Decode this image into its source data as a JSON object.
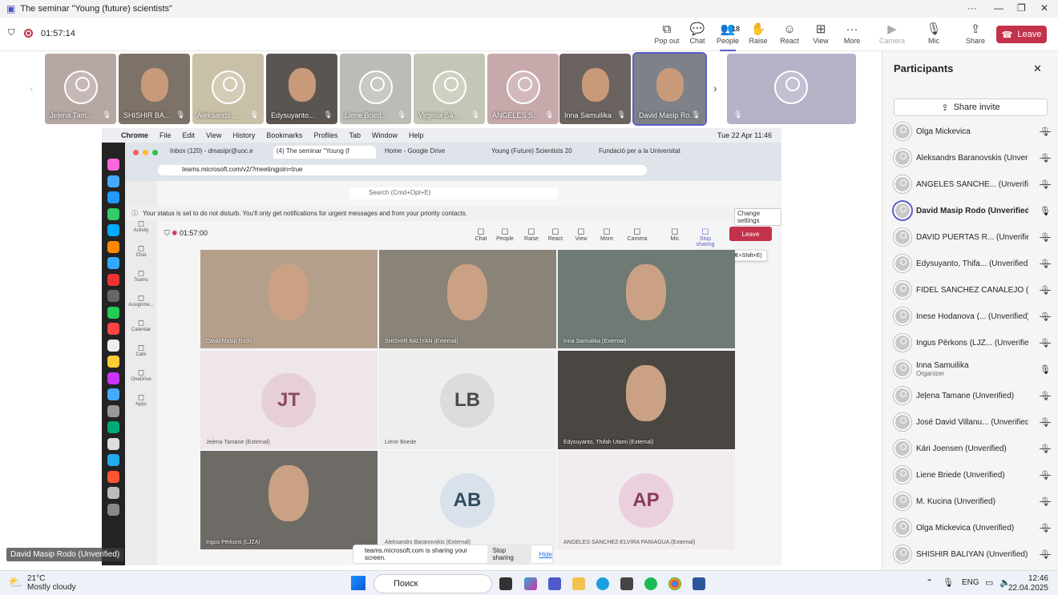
{
  "window": {
    "title": "The seminar \"Young (future) scientists\""
  },
  "meeting": {
    "timer": "01:57:14"
  },
  "toolbar": [
    {
      "label": "Pop out",
      "icon": "pop-out-icon"
    },
    {
      "label": "Chat",
      "icon": "chat-icon"
    },
    {
      "label": "People",
      "icon": "people-icon",
      "count": "18"
    },
    {
      "label": "Raise",
      "icon": "raise-hand-icon"
    },
    {
      "label": "React",
      "icon": "react-icon"
    },
    {
      "label": "View",
      "icon": "view-icon"
    },
    {
      "label": "More",
      "icon": "more-icon"
    },
    {
      "label": "Camera",
      "icon": "camera-icon"
    },
    {
      "label": "Mic",
      "icon": "mic-icon"
    },
    {
      "label": "Share",
      "icon": "share-icon"
    }
  ],
  "leave_label": "Leave",
  "strip": [
    {
      "name": "Jeļena Tam...",
      "bg": "#b7a7a3",
      "photo": false
    },
    {
      "name": "SHISHIR BA...",
      "bg": "#7d7268",
      "photo": true
    },
    {
      "name": "Aleksands ...",
      "bg": "#c8c1a7",
      "photo": false
    },
    {
      "name": "Edysuyanto...",
      "bg": "#5a5550",
      "photo": true
    },
    {
      "name": "Liene Bried...",
      "bg": "#b9bdb6",
      "photo": false
    },
    {
      "name": "Virginia Sá...",
      "bg": "#c3c7b5",
      "photo": false
    },
    {
      "name": "ANGELES S...",
      "bg": "#c7a9ac",
      "photo": false
    },
    {
      "name": "Inna Samuilika",
      "bg": "#6b6360",
      "photo": true
    },
    {
      "name": "David Masip Ro...",
      "bg": "#7e8188",
      "photo": true
    },
    {
      "name": "",
      "bg": "#b5b1c7",
      "photo": false
    }
  ],
  "shared": {
    "mac_menu": [
      "Chrome",
      "File",
      "Edit",
      "View",
      "History",
      "Bookmarks",
      "Profiles",
      "Tab",
      "Window",
      "Help"
    ],
    "mac_clock": "Tue 22 Apr  11:46",
    "tabs": [
      "Inbox (120) - dmasipr@uoc.e",
      "(4) The seminar \"Young (f",
      "Home - Google Drive",
      "Young (Future) Scientists 20",
      "Fundació per a la Universitat"
    ],
    "url": "teams.microsoft.com/v2/?meetingjoin=true",
    "search": "Search (Cmd+Opt+E)",
    "banner": "Your status is set to do not disturb. You'll only get notifications for urgent messages and from your priority contacts.",
    "change_settings": "Change settings",
    "timer": "01:57:00",
    "rail": [
      "Activity",
      "Chat",
      "Teams",
      "Assignme...",
      "Calendar",
      "Calls",
      "OneDrive",
      "Apps"
    ],
    "controls": [
      "Chat",
      "People",
      "Raise",
      "React",
      "View",
      "More",
      "Camera",
      "Mic",
      "Stop sharing"
    ],
    "people_count": "18",
    "leave": "Leave",
    "tooltip": "Stop sharing (⌘+Shift+E)",
    "grid": [
      {
        "label": "David Masip Rodo",
        "initials": "",
        "bg": "#b4a08a"
      },
      {
        "label": "SHISHIR BALIYAN (External)",
        "initials": "",
        "bg": "#8a8378"
      },
      {
        "label": "Inna Samuilika (External)",
        "initials": "",
        "bg": "#6f7a74"
      },
      {
        "label": "Jeļena Tamane (External)",
        "initials": "JT",
        "bg": "#efe6ea",
        "ini_bg": "#e6cfd8",
        "ini_color": "#8b4c5f"
      },
      {
        "label": "Liene Briede",
        "initials": "LB",
        "bg": "#eeeeef",
        "ini_bg": "#dcdcde",
        "ini_color": "#4a4a4a"
      },
      {
        "label": "Edysuyanto, Thifah Utami (External)",
        "initials": "",
        "bg": "#4a4641"
      },
      {
        "label": "Ingus Pērkons (LJZA)",
        "initials": "",
        "bg": "#6e6a66"
      },
      {
        "label": "Aleksandrs Baranovskis (External)",
        "initials": "AB",
        "bg": "#eef0f2",
        "ini_bg": "#d9e2ea",
        "ini_color": "#2f4a5e"
      },
      {
        "label": "ANGELES SANCHEZ-ELVIRA PANIAGUA (External)",
        "initials": "AP",
        "bg": "#f1ecef",
        "ini_bg": "#ead0dc",
        "ini_color": "#8a3a5e"
      }
    ],
    "sharing_text": "teams.microsoft.com is sharing your screen.",
    "stop_sharing": "Stop sharing",
    "hide": "Hide"
  },
  "selfview_label": "David Masip Rodo (Unverified)",
  "panel": {
    "title": "Participants",
    "share_invite": "Share invite",
    "people": [
      {
        "name": "Olga Mickevica",
        "sub": "",
        "mic": "muted"
      },
      {
        "name": "Aleksandrs Baranovskis (Unver...",
        "sub": "",
        "mic": "muted"
      },
      {
        "name": "ANGELES SANCHE... (Unverified)",
        "sub": "",
        "mic": "muted"
      },
      {
        "name": "David Masip Rodo (Unverified)",
        "sub": "",
        "mic": "on",
        "bold": true
      },
      {
        "name": "DAVID PUERTAS R... (Unverified)",
        "sub": "",
        "mic": "muted"
      },
      {
        "name": "Edysuyanto, Thifa... (Unverified)",
        "sub": "",
        "mic": "muted"
      },
      {
        "name": "FIDEL SÁNCHEZ CANALEJO (U...",
        "sub": "",
        "mic": "muted"
      },
      {
        "name": "Inese Hodanova (... (Unverified)",
        "sub": "",
        "mic": "muted"
      },
      {
        "name": "Ingus Pērkons (LJZ... (Unverified)",
        "sub": "",
        "mic": "muted"
      },
      {
        "name": "Inna Samuilika",
        "sub": "Organizer",
        "mic": "on"
      },
      {
        "name": "Jeļena Tamane (Unverified)",
        "sub": "",
        "mic": "muted"
      },
      {
        "name": "José David Villanu... (Unverified)",
        "sub": "",
        "mic": "muted"
      },
      {
        "name": "Kári Joensen (Unverified)",
        "sub": "",
        "mic": "muted"
      },
      {
        "name": "Liene Briede (Unverified)",
        "sub": "",
        "mic": "muted"
      },
      {
        "name": "M. Kucina (Unverified)",
        "sub": "",
        "mic": "muted"
      },
      {
        "name": "Olga Mickevica (Unverified)",
        "sub": "",
        "mic": "muted"
      },
      {
        "name": "SHISHIR BALIYAN (Unverified)",
        "sub": "",
        "mic": "muted"
      }
    ]
  },
  "taskbar": {
    "weather_temp": "21°C",
    "weather_text": "Mostly cloudy",
    "search": "Поиск",
    "lang": "ENG",
    "time": "12:46",
    "date": "22.04.2025"
  }
}
